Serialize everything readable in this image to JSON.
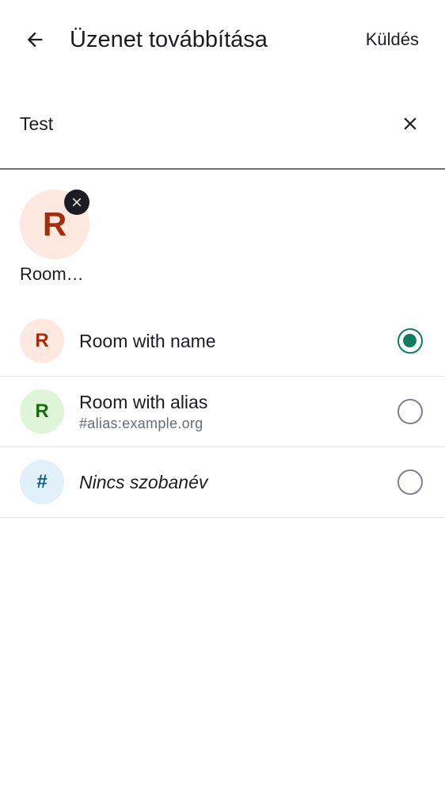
{
  "header": {
    "title": "Üzenet továbbítása",
    "send_label": "Küldés",
    "back_icon": "arrow-left-icon"
  },
  "search": {
    "value": "Test",
    "clear_icon": "close-icon"
  },
  "selected": [
    {
      "initial": "R",
      "label": "Room…",
      "avatar_bg": "#fde9e0",
      "avatar_fg": "#a32d0c"
    }
  ],
  "rooms": [
    {
      "initial": "R",
      "title": "Room with name",
      "subtitle": "",
      "selected": true,
      "avatar_bg": "#fde9e0",
      "avatar_fg": "#a32d0c"
    },
    {
      "initial": "R",
      "title": "Room with alias",
      "subtitle": "#alias:example.org",
      "selected": false,
      "avatar_bg": "#dff5d8",
      "avatar_fg": "#1a6b16"
    },
    {
      "initial": "#",
      "title": "Nincs szobanév",
      "subtitle": "",
      "selected": false,
      "avatar_bg": "#e0f1fa",
      "avatar_fg": "#0f5e8a"
    }
  ],
  "colors": {
    "accent": "#0d7d5e",
    "text": "#1b1d22",
    "secondary_text": "#656d77"
  }
}
